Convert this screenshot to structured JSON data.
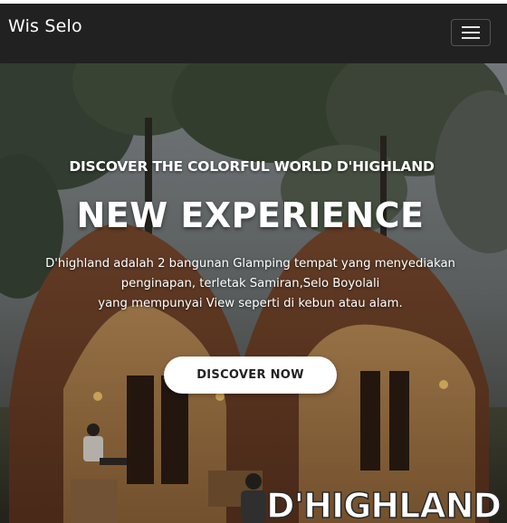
{
  "navbar": {
    "brand": "Wis Selo",
    "menu_icon": "hamburger-menu-icon",
    "background_color": "#212121"
  },
  "hero": {
    "subtitle": "DISCOVER THE COLORFUL WORLD D'HIGHLAND",
    "title": "NEW EXPERIENCE",
    "description_lines": [
      "D'highland adalah 2 bangunan Glamping tempat yang menyediakan",
      "penginapan, terletak Samiran,Selo Boyolali",
      "yang mempunyai View seperti di kebun atau alam."
    ],
    "cta_label": "DISCOVER NOW",
    "image_watermark": "D'HIGHLAND"
  }
}
